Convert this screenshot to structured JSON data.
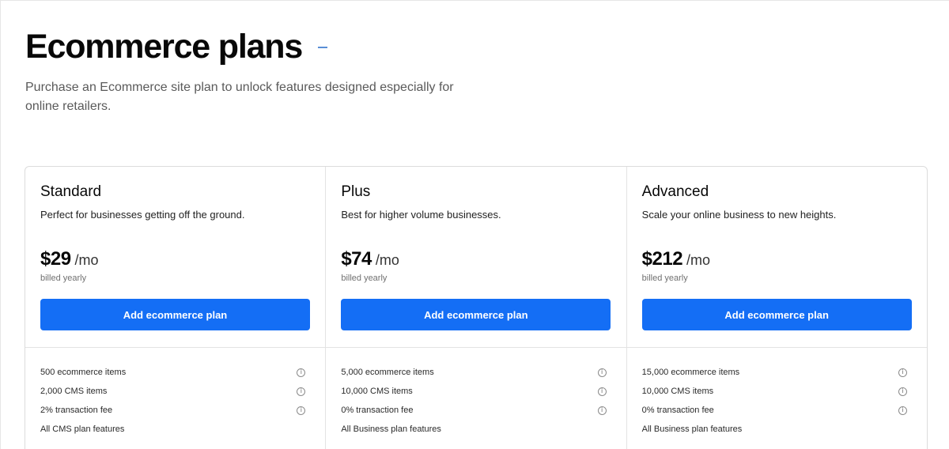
{
  "header": {
    "title": "Ecommerce plans",
    "subtitle": "Purchase an Ecommerce site plan to unlock features designed especially for online retailers."
  },
  "plans": [
    {
      "name": "Standard",
      "description": "Perfect for businesses getting off the ground.",
      "price": "$29",
      "per": "/mo",
      "billing": "billed yearly",
      "cta_label": "Add ecommerce plan",
      "features": [
        {
          "label": "500 ecommerce items",
          "info": true
        },
        {
          "label": "2,000 CMS items",
          "info": true
        },
        {
          "label": "2% transaction fee",
          "info": true
        },
        {
          "label": "All CMS plan features",
          "info": false
        }
      ]
    },
    {
      "name": "Plus",
      "description": "Best for higher volume businesses.",
      "price": "$74",
      "per": "/mo",
      "billing": "billed yearly",
      "cta_label": "Add ecommerce plan",
      "features": [
        {
          "label": "5,000 ecommerce items",
          "info": true
        },
        {
          "label": "10,000 CMS items",
          "info": true
        },
        {
          "label": "0% transaction fee",
          "info": true
        },
        {
          "label": "All Business plan features",
          "info": false
        }
      ]
    },
    {
      "name": "Advanced",
      "description": "Scale your online business to new heights.",
      "price": "$212",
      "per": "/mo",
      "billing": "billed yearly",
      "cta_label": "Add ecommerce plan",
      "features": [
        {
          "label": "15,000 ecommerce items",
          "info": true
        },
        {
          "label": "10,000 CMS items",
          "info": true
        },
        {
          "label": "0% transaction fee",
          "info": true
        },
        {
          "label": "All Business plan features",
          "info": false
        }
      ]
    }
  ],
  "icons": {
    "info": "info-icon"
  },
  "colors": {
    "accent": "#146ef5",
    "title_dash": "#5a8fd6"
  }
}
